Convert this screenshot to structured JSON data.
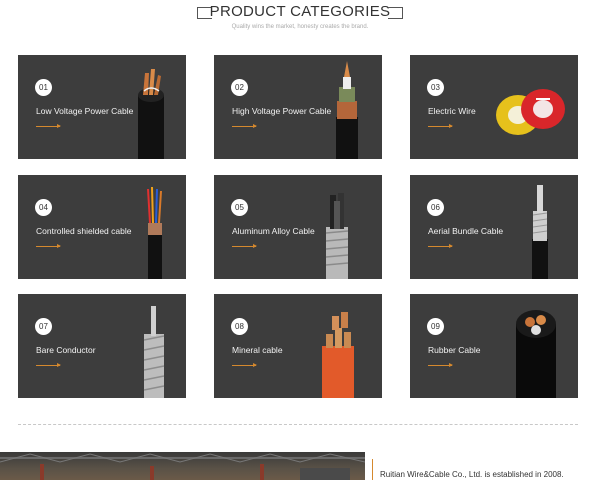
{
  "header": {
    "title": "PRODUCT CATEGORIES",
    "subtitle": "Quality wins the market, honesty creates the brand."
  },
  "categories": [
    {
      "num": "01",
      "name": "Low Voltage Power Cable"
    },
    {
      "num": "02",
      "name": "High Voltage Power Cable"
    },
    {
      "num": "03",
      "name": "Electric Wire"
    },
    {
      "num": "04",
      "name": "Controlled shielded cable"
    },
    {
      "num": "05",
      "name": "Aluminum Alloy Cable"
    },
    {
      "num": "06",
      "name": "Aerial Bundle Cable"
    },
    {
      "num": "07",
      "name": "Bare Conductor"
    },
    {
      "num": "08",
      "name": "Mineral cable"
    },
    {
      "num": "09",
      "name": "Rubber Cable"
    }
  ],
  "about": {
    "text": "Ruitian Wire&Cable Co., Ltd. is established in 2008."
  },
  "colors": {
    "card_bg": "#3d3d3d",
    "accent": "#d5892e",
    "text_light": "#f2f2f2"
  }
}
